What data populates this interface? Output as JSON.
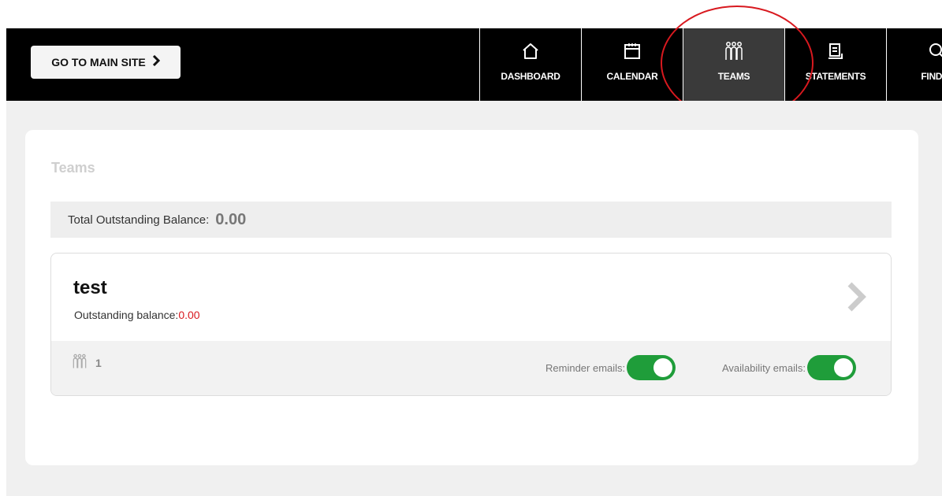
{
  "header": {
    "main_site_label": "GO TO MAIN SITE",
    "nav": [
      {
        "label": "DASHBOARD",
        "icon": "home-icon"
      },
      {
        "label": "CALENDAR",
        "icon": "calendar-icon"
      },
      {
        "label": "TEAMS",
        "icon": "team-icon",
        "active": true
      },
      {
        "label": "STATEMENTS",
        "icon": "statement-icon"
      },
      {
        "label": "FIND RI",
        "icon": "search-icon"
      }
    ]
  },
  "page": {
    "title": "Teams",
    "total_label": "Total Outstanding Balance:",
    "total_value": "0.00"
  },
  "team": {
    "name": "test",
    "balance_label": "Outstanding balance:",
    "balance_value": "0.00",
    "member_count": "1",
    "reminder_label": "Reminder emails:",
    "availability_label": "Availability emails:",
    "reminder_on": true,
    "availability_on": true
  },
  "colors": {
    "toggle_on": "#1f9d3a",
    "balance_red": "#d8191f",
    "annotation_red": "#d8191f"
  }
}
